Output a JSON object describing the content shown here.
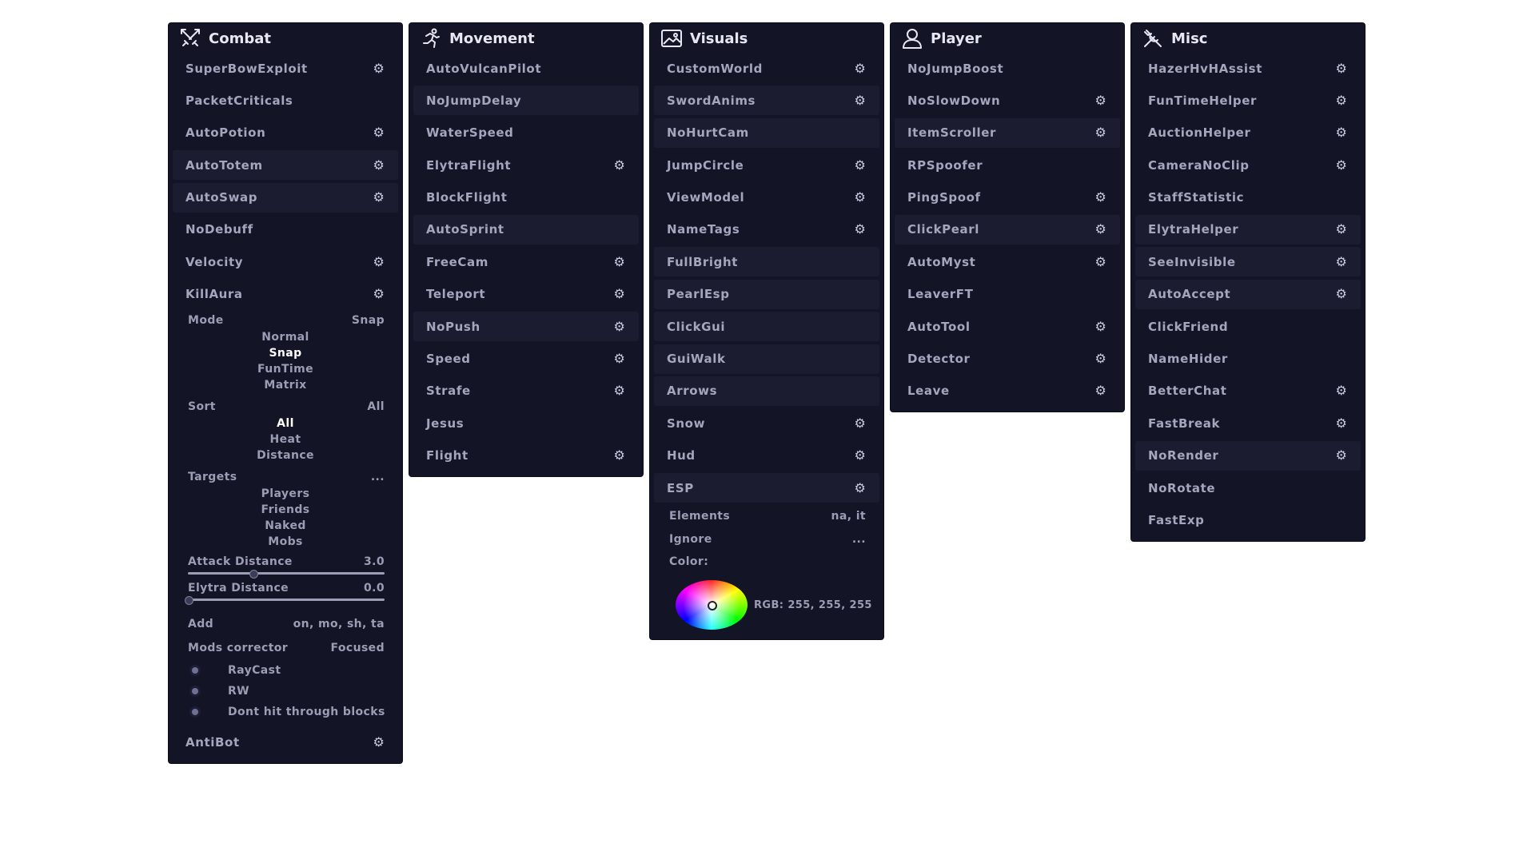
{
  "panels": {
    "combat": {
      "title": "Combat",
      "icon": "swords-icon",
      "modules": [
        {
          "name": "SuperBowExploit",
          "gear": true
        },
        {
          "name": "PacketCriticals",
          "gear": false
        },
        {
          "name": "AutoPotion",
          "gear": true
        },
        {
          "name": "AutoTotem",
          "gear": true
        },
        {
          "name": "AutoSwap",
          "gear": true
        },
        {
          "name": "NoDebuff",
          "gear": false
        },
        {
          "name": "Velocity",
          "gear": true
        },
        {
          "name": "KillAura",
          "gear": true
        }
      ],
      "killaura": {
        "mode_label": "Mode",
        "mode_value": "Snap",
        "mode_options": [
          "Normal",
          "Snap",
          "FunTime",
          "Matrix"
        ],
        "sort_label": "Sort",
        "sort_value": "All",
        "sort_options": [
          "All",
          "Heat",
          "Distance"
        ],
        "targets_label": "Targets",
        "targets_value": "...",
        "targets_options": [
          "Players",
          "Friends",
          "Naked",
          "Mobs"
        ],
        "attack_distance_label": "Attack Distance",
        "attack_distance_value": "3.0",
        "attack_distance_fraction": 0.33,
        "elytra_distance_label": "Elytra Distance",
        "elytra_distance_value": "0.0",
        "elytra_distance_fraction": 0.0,
        "add_label": "Add",
        "add_value": "on, mo, sh, ta",
        "mods_corrector_label": "Mods corrector",
        "mods_corrector_value": "Focused",
        "checks": [
          "RayCast",
          "RW",
          "Dont hit through blocks"
        ]
      },
      "last_module": {
        "name": "AntiBot",
        "gear": true
      }
    },
    "movement": {
      "title": "Movement",
      "icon": "running-person-icon",
      "modules": [
        {
          "name": "AutoVulcanPilot",
          "gear": false
        },
        {
          "name": "NoJumpDelay",
          "gear": false
        },
        {
          "name": "WaterSpeed",
          "gear": false
        },
        {
          "name": "ElytraFlight",
          "gear": true
        },
        {
          "name": "BlockFlight",
          "gear": false
        },
        {
          "name": "AutoSprint",
          "gear": false
        },
        {
          "name": "FreeCam",
          "gear": true
        },
        {
          "name": "Teleport",
          "gear": true
        },
        {
          "name": "NoPush",
          "gear": true
        },
        {
          "name": "Speed",
          "gear": true
        },
        {
          "name": "Strafe",
          "gear": true
        },
        {
          "name": "Jesus",
          "gear": false
        },
        {
          "name": "Flight",
          "gear": true
        }
      ]
    },
    "visuals": {
      "title": "Visuals",
      "icon": "image-icon",
      "modules": [
        {
          "name": "CustomWorld",
          "gear": true
        },
        {
          "name": "SwordAnims",
          "gear": true
        },
        {
          "name": "NoHurtCam",
          "gear": false
        },
        {
          "name": "JumpCircle",
          "gear": true
        },
        {
          "name": "ViewModel",
          "gear": true
        },
        {
          "name": "NameTags",
          "gear": true
        },
        {
          "name": "FullBright",
          "gear": false
        },
        {
          "name": "PearlEsp",
          "gear": false
        },
        {
          "name": "ClickGui",
          "gear": false
        },
        {
          "name": "GuiWalk",
          "gear": false
        },
        {
          "name": "Arrows",
          "gear": false
        },
        {
          "name": "Snow",
          "gear": true
        },
        {
          "name": "Hud",
          "gear": true
        },
        {
          "name": "ESP",
          "gear": true
        }
      ],
      "esp": {
        "elements_label": "Elements",
        "elements_value": "na, it",
        "ignore_label": "Ignore",
        "ignore_value": "...",
        "color_label": "Color:",
        "rgb_text": "RGB: 255, 255, 255"
      }
    },
    "player": {
      "title": "Player",
      "icon": "user-icon",
      "modules": [
        {
          "name": "NoJumpBoost",
          "gear": false
        },
        {
          "name": "NoSlowDown",
          "gear": true
        },
        {
          "name": "ItemScroller",
          "gear": true
        },
        {
          "name": "RPSpoofer",
          "gear": false
        },
        {
          "name": "PingSpoof",
          "gear": true
        },
        {
          "name": "ClickPearl",
          "gear": true
        },
        {
          "name": "AutoMyst",
          "gear": true
        },
        {
          "name": "LeaverFT",
          "gear": false
        },
        {
          "name": "AutoTool",
          "gear": true
        },
        {
          "name": "Detector",
          "gear": true
        },
        {
          "name": "Leave",
          "gear": true
        }
      ]
    },
    "misc": {
      "title": "Misc",
      "icon": "tools-icon",
      "modules": [
        {
          "name": "HazerHvHAssist",
          "gear": true
        },
        {
          "name": "FunTimeHelper",
          "gear": true
        },
        {
          "name": "AuctionHelper",
          "gear": true
        },
        {
          "name": "CameraNoClip",
          "gear": true
        },
        {
          "name": "StaffStatistic",
          "gear": false
        },
        {
          "name": "ElytraHelper",
          "gear": true
        },
        {
          "name": "SeeInvisible",
          "gear": true
        },
        {
          "name": "AutoAccept",
          "gear": true
        },
        {
          "name": "ClickFriend",
          "gear": false
        },
        {
          "name": "NameHider",
          "gear": false
        },
        {
          "name": "BetterChat",
          "gear": true
        },
        {
          "name": "FastBreak",
          "gear": true
        },
        {
          "name": "NoRender",
          "gear": true
        },
        {
          "name": "NoRotate",
          "gear": false
        },
        {
          "name": "FastExp",
          "gear": false
        }
      ]
    }
  },
  "colors": {
    "panel_bg": "#141427",
    "row_highlight": "#1c1c31",
    "text": "#a4a6bd",
    "title": "#e6e7f2"
  }
}
